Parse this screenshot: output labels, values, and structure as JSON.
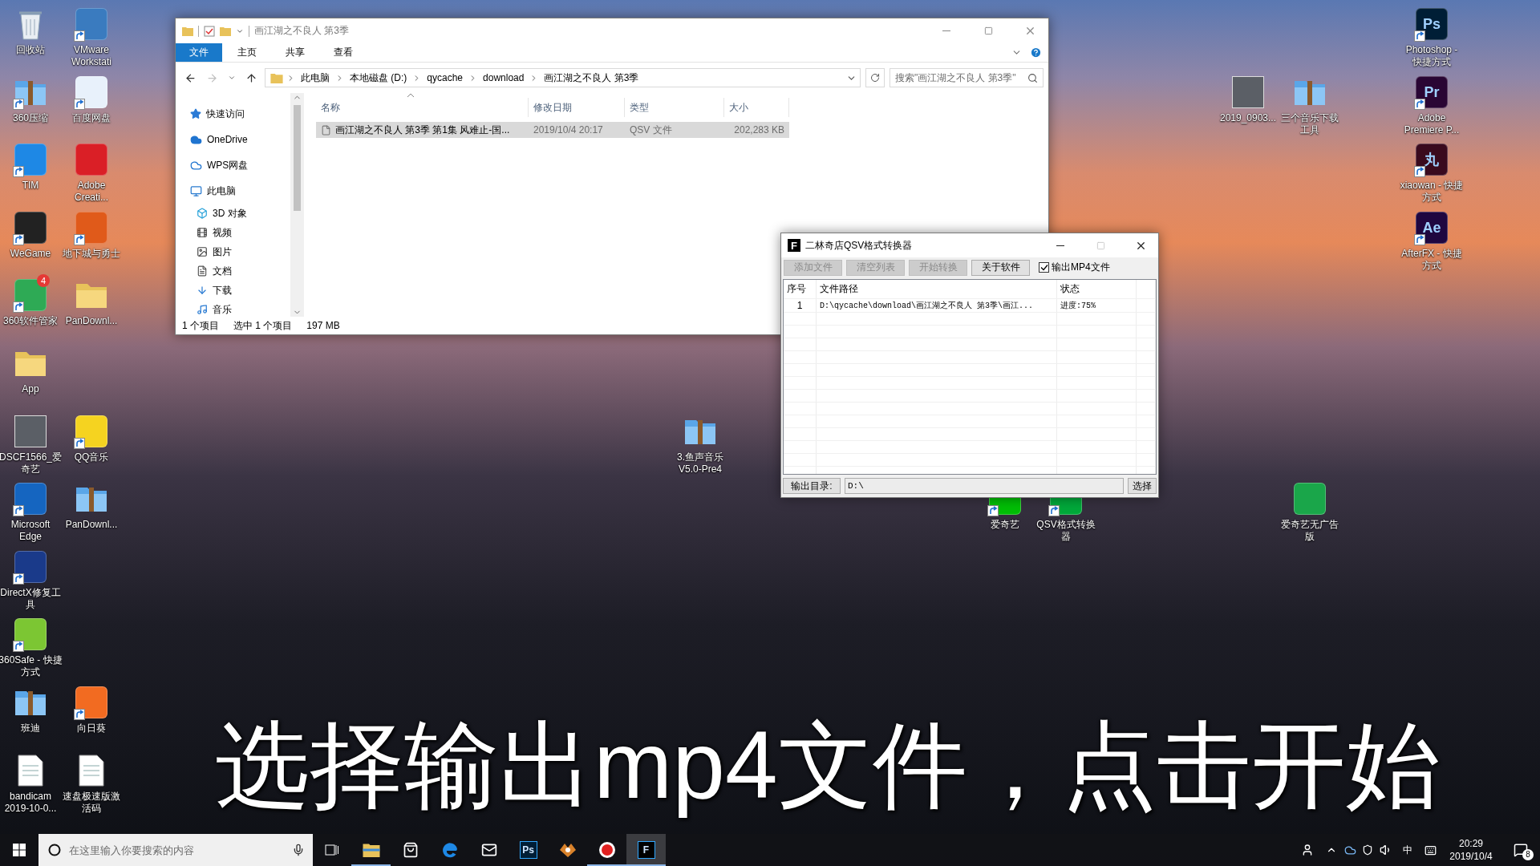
{
  "desktop_icons": [
    {
      "label": "回收站",
      "kind": "recycle",
      "shortcut": false
    },
    {
      "label": "360压缩",
      "kind": "archive",
      "shortcut": true
    },
    {
      "label": "TIM",
      "kind": "app",
      "color": "#1e88e5",
      "shortcut": true
    },
    {
      "label": "WeGame",
      "kind": "app",
      "color": "#222222",
      "shortcut": true
    },
    {
      "label": "360软件管家",
      "kind": "app",
      "color": "#2eaa55",
      "badge": "4",
      "shortcut": true
    },
    {
      "label": "App",
      "kind": "folder",
      "shortcut": false
    },
    {
      "label": "DSCF1566_爱奇艺",
      "kind": "photo",
      "shortcut": false
    },
    {
      "label": "Microsoft Edge",
      "kind": "app",
      "color": "#1565c0",
      "shortcut": true
    },
    {
      "label": "DirectX修复工具",
      "kind": "app",
      "color": "#1a3a8a",
      "shortcut": true
    },
    {
      "label": "360Safe - 快捷方式",
      "kind": "app",
      "color": "#7cc633",
      "shortcut": true
    },
    {
      "label": "班迪",
      "kind": "archive",
      "shortcut": false
    },
    {
      "label": "bandicam 2019-10-0...",
      "kind": "document",
      "shortcut": false
    },
    {
      "label": "VMware Workstati",
      "kind": "app",
      "color": "#3a7bbf",
      "shortcut": true
    },
    {
      "label": "百度网盘",
      "kind": "app",
      "color": "#e8f1fb",
      "shortcut": true
    },
    {
      "label": "Adobe Creati...",
      "kind": "app",
      "color": "#da1f26",
      "shortcut": false
    },
    {
      "label": "地下城与勇士",
      "kind": "app",
      "color": "#e05a1a",
      "shortcut": true
    },
    {
      "label": "PanDownl...",
      "kind": "folder",
      "shortcut": false
    },
    {
      "label": "QQ音乐",
      "kind": "app",
      "color": "#f5d320",
      "shortcut": true
    },
    {
      "label": "PanDownl...",
      "kind": "archive",
      "shortcut": false
    },
    {
      "label": "向日葵",
      "kind": "app",
      "color": "#f26b21",
      "shortcut": true
    },
    {
      "label": "速盘极速版激活码",
      "kind": "document",
      "shortcut": false
    },
    {
      "label": "3.鱼声音乐 V5.0-Pre4",
      "kind": "archive",
      "shortcut": false
    },
    {
      "label": "爱奇艺",
      "kind": "app",
      "color": "#00be06",
      "shortcut": true
    },
    {
      "label": "QSV格式转换器",
      "kind": "app",
      "color": "#00a83a",
      "shortcut": true
    },
    {
      "label": "2019_0903...",
      "kind": "photo",
      "shortcut": false
    },
    {
      "label": "三个音乐下载工具",
      "kind": "archive",
      "shortcut": false
    },
    {
      "label": "爱奇艺无广告版",
      "kind": "app",
      "color": "#1aa64a",
      "shortcut": false
    },
    {
      "label": "Photoshop - 快捷方式",
      "kind": "app",
      "color": "#001e36",
      "glyph": "Ps",
      "shortcut": true
    },
    {
      "label": "Adobe Premiere P...",
      "kind": "app",
      "color": "#2a0634",
      "glyph": "Pr",
      "shortcut": true
    },
    {
      "label": "xiaowan - 快捷方式",
      "kind": "app",
      "color": "#3a0a1e",
      "glyph": "丸",
      "shortcut": true
    },
    {
      "label": "AfterFX - 快捷方式",
      "kind": "app",
      "color": "#1f0740",
      "glyph": "Ae",
      "shortcut": true
    }
  ],
  "explorer": {
    "title": "画江湖之不良人 第3季",
    "ribbon_tabs": [
      {
        "label": "文件",
        "selected": true
      },
      {
        "label": "主页",
        "selected": false
      },
      {
        "label": "共享",
        "selected": false
      },
      {
        "label": "查看",
        "selected": false
      }
    ],
    "navigation": {
      "back_disabled": false,
      "forward_disabled": true
    },
    "breadcrumb": [
      "此电脑",
      "本地磁盘 (D:)",
      "qycache",
      "download",
      "画江湖之不良人 第3季"
    ],
    "search": {
      "placeholder": "搜索\"画江湖之不良人 第3季\""
    },
    "nav_items": [
      {
        "label": "快速访问"
      },
      {
        "label": "OneDrive"
      },
      {
        "label": "WPS网盘"
      },
      {
        "label": "此电脑",
        "children": [
          {
            "label": "3D 对象"
          },
          {
            "label": "视频"
          },
          {
            "label": "图片"
          },
          {
            "label": "文档"
          },
          {
            "label": "下载"
          },
          {
            "label": "音乐"
          }
        ]
      }
    ],
    "columns": [
      "名称",
      "修改日期",
      "类型",
      "大小"
    ],
    "rows": [
      {
        "name": "画江湖之不良人 第3季 第1集 风难止-国...",
        "modified": "2019/10/4 20:17",
        "type": "QSV 文件",
        "size": "202,283 KB",
        "selected": true
      }
    ],
    "status": {
      "item_count": "1 个项目",
      "selection": "选中 1 个项目",
      "selection_size": "197 MB"
    }
  },
  "converter": {
    "logo_letter": "F",
    "title": "二林奇店QSV格式转换器",
    "buttons": [
      {
        "label": "添加文件",
        "disabled": true
      },
      {
        "label": "清空列表",
        "disabled": true
      },
      {
        "label": "开始转换",
        "disabled": true
      },
      {
        "label": "关于软件",
        "disabled": false
      }
    ],
    "output_mp4": {
      "label": "输出MP4文件",
      "checked": true
    },
    "columns": [
      "序号",
      "文件路径",
      "状态"
    ],
    "rows": [
      {
        "index": "1",
        "path": "D:\\qycache\\download\\画江湖之不良人 第3季\\画江...",
        "status": "进度:75%"
      }
    ],
    "output_dir": {
      "label": "输出目录:",
      "value": "D:\\"
    },
    "choose_button": "选择"
  },
  "caption": "选择输出mp4文件，点击开始",
  "taskbar": {
    "search": {
      "placeholder": "在这里输入你要搜索的内容"
    },
    "apps": [
      {
        "kind": "explorer",
        "running": true,
        "selected": false
      },
      {
        "kind": "store",
        "running": false,
        "selected": false
      },
      {
        "kind": "edge",
        "running": false,
        "selected": false
      },
      {
        "kind": "mail",
        "running": false,
        "selected": false
      },
      {
        "kind": "tile",
        "glyph": "Ps",
        "color": "#001e36",
        "running": false,
        "selected": false
      },
      {
        "kind": "game",
        "running": false,
        "selected": false
      },
      {
        "kind": "record",
        "running": true,
        "selected": false
      },
      {
        "kind": "tile",
        "glyph": "F",
        "color": "#000000",
        "running": true,
        "selected": true
      }
    ],
    "input_method": "中",
    "time": "20:29",
    "date": "2019/10/4",
    "notification_count": "8"
  }
}
